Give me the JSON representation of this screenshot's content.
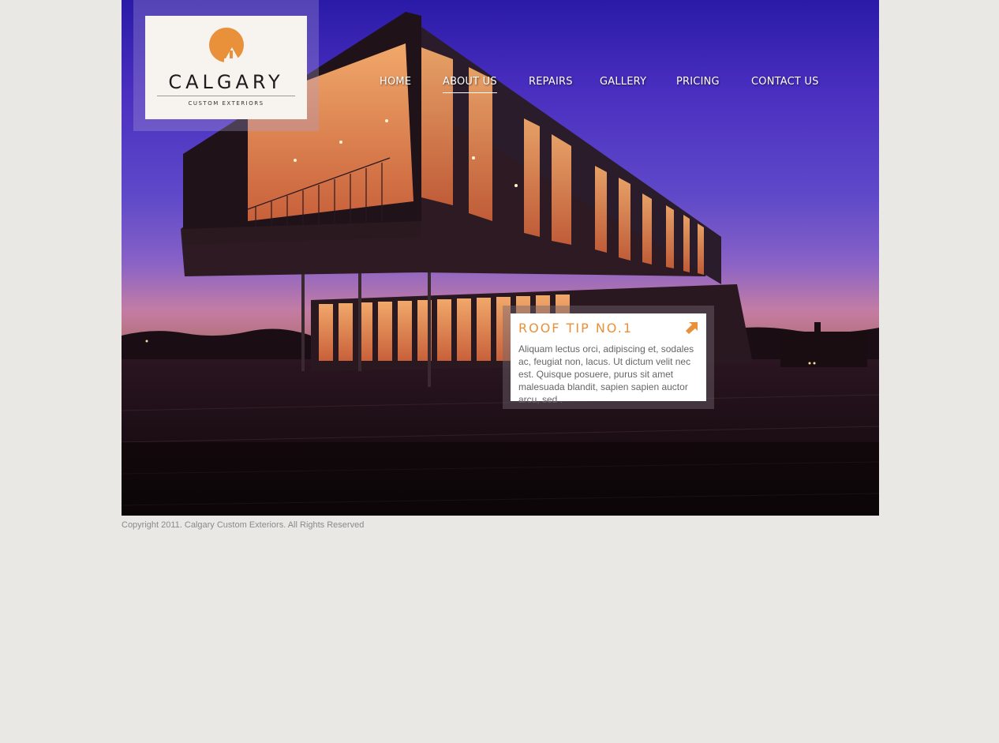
{
  "brand": {
    "name": "CALGARY",
    "tagline": "CUSTOM EXTERIORS",
    "accent_color": "#e8913a",
    "logo_icon": "sun-house-icon"
  },
  "nav": {
    "items": [
      {
        "label": "HOME",
        "active": false
      },
      {
        "label": "ABOUT US",
        "active": true
      },
      {
        "label": "REPAIRS",
        "active": false
      },
      {
        "label": "GALLERY",
        "active": false
      },
      {
        "label": "PRICING",
        "active": false
      },
      {
        "label": "CONTACT US",
        "active": false
      }
    ]
  },
  "hero": {
    "image": "modern-house-at-dusk"
  },
  "tip": {
    "title": "ROOF TIP NO.1",
    "body": "Aliquam lectus orci, adipiscing et, sodales ac, feugiat non, lacus. Ut dictum velit nec est. Quisque posuere, purus sit amet malesuada blandit, sapien sapien auctor arcu, sed .",
    "arrow_icon": "arrow-up-right-icon"
  },
  "footer": {
    "copyright": "Copyright 2011. Calgary Custom Exteriors. All Rights Reserved"
  }
}
